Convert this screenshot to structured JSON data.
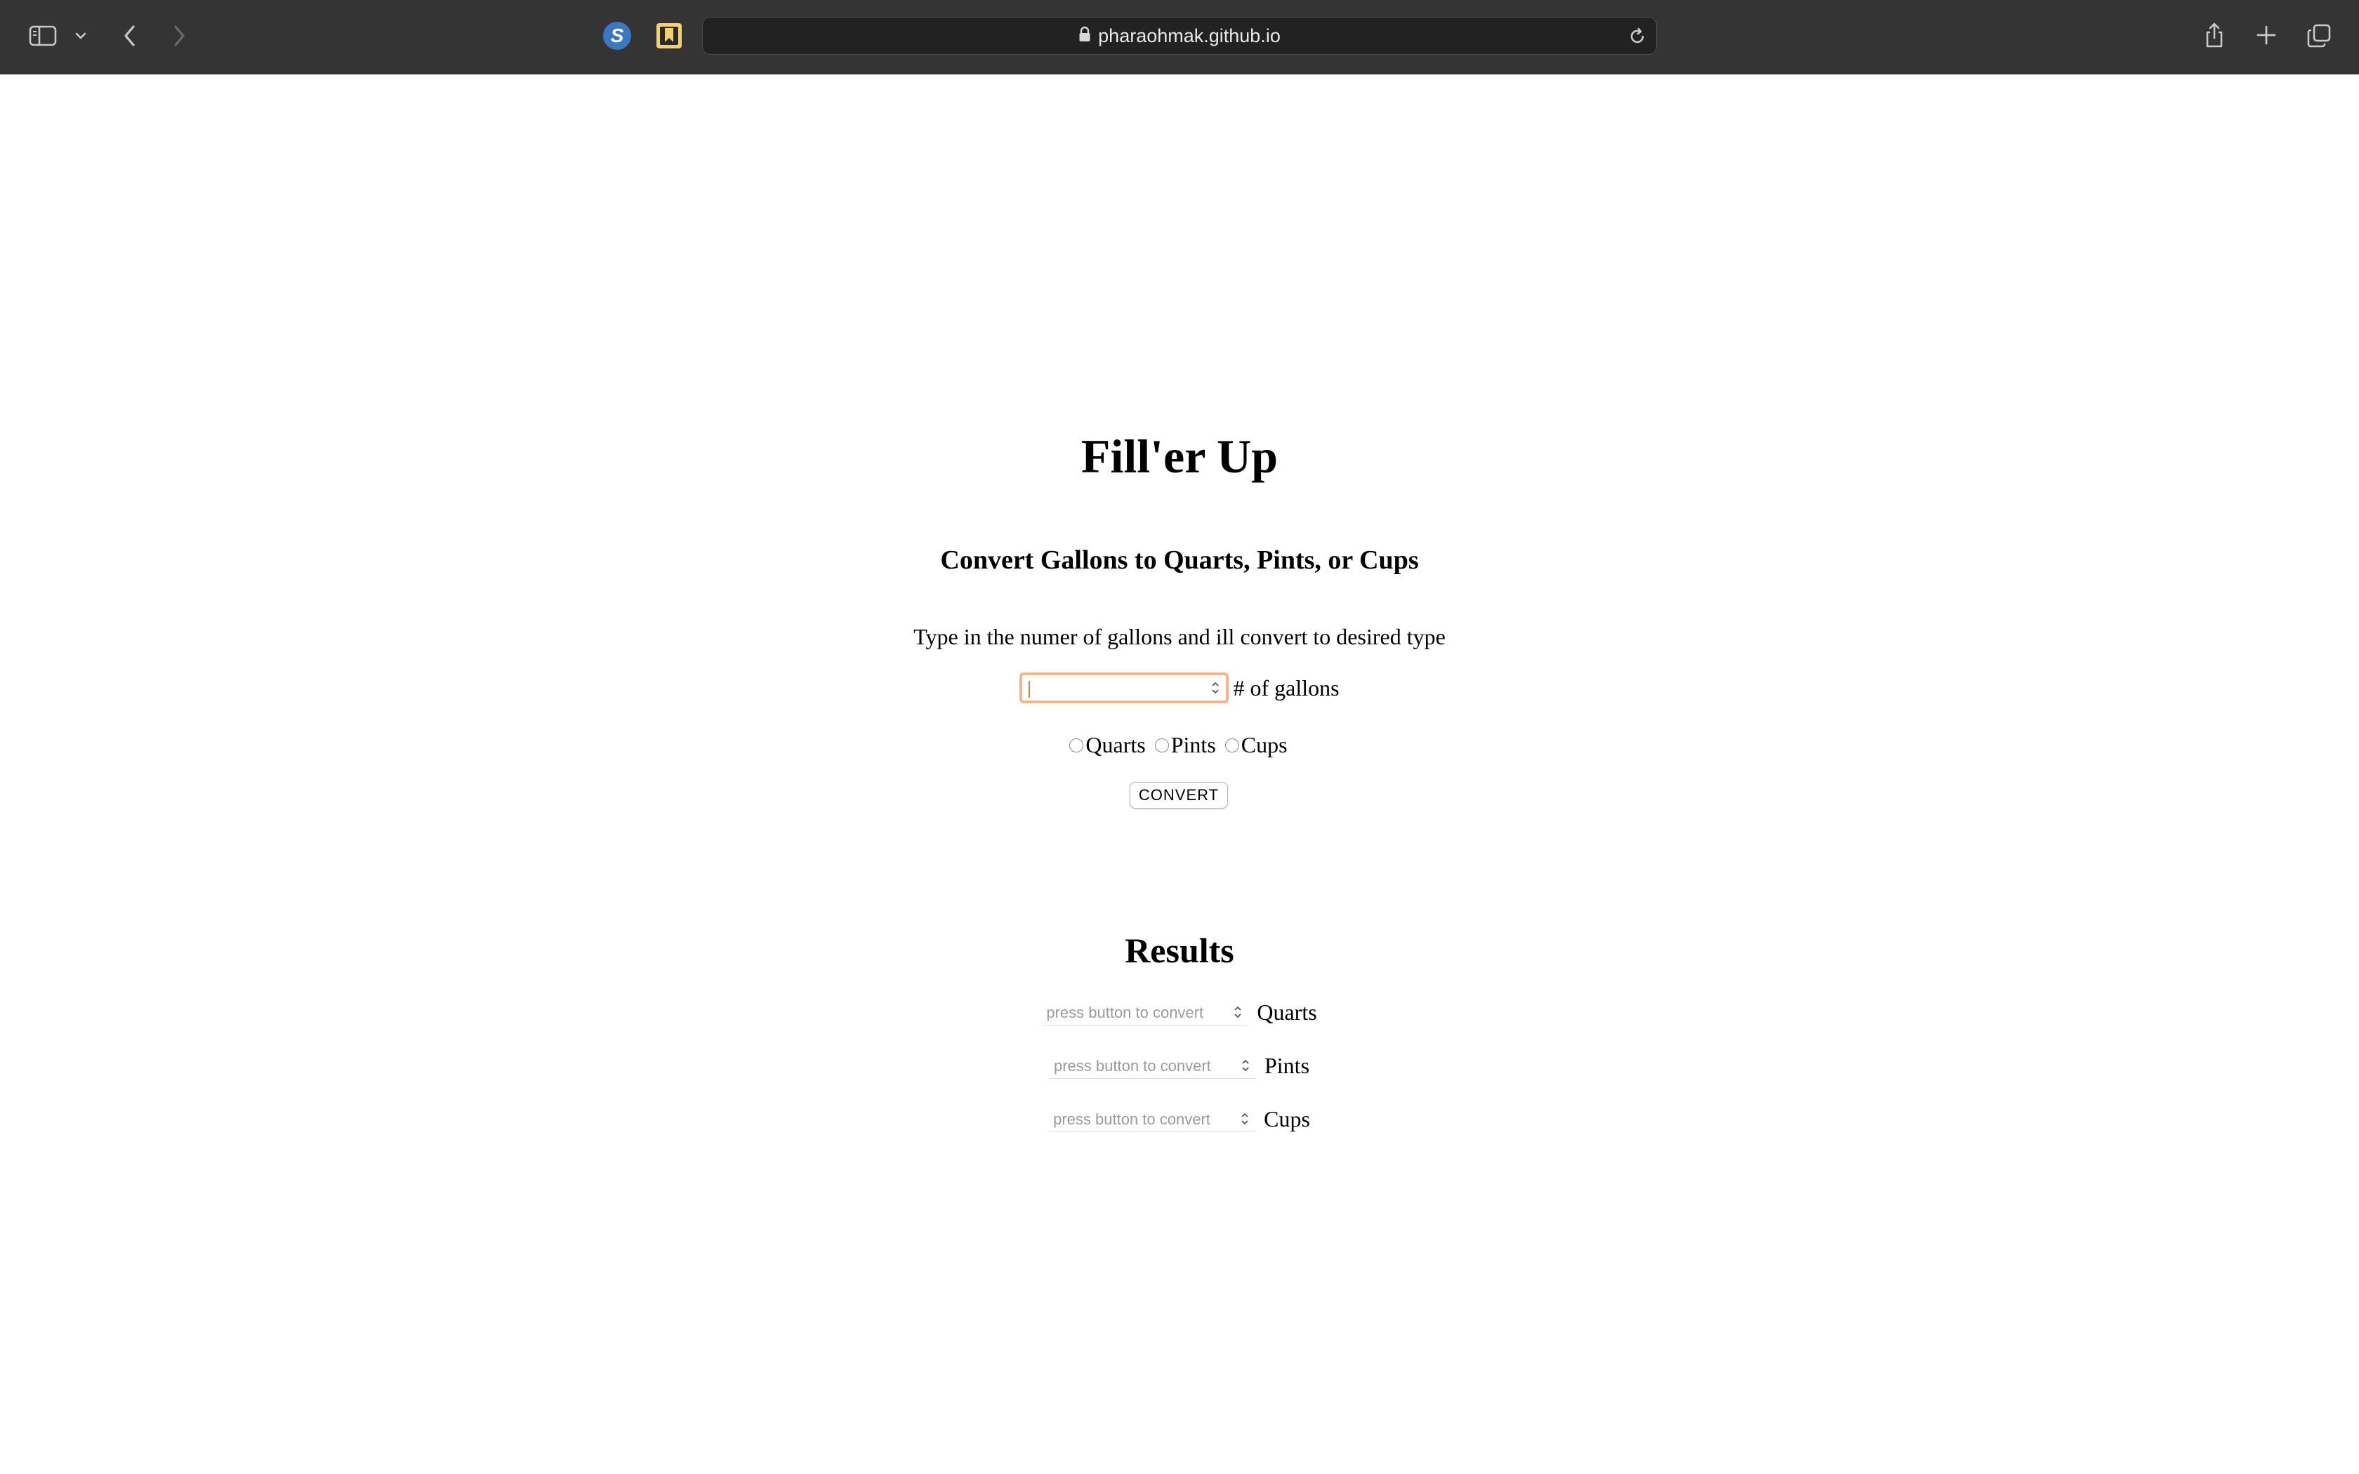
{
  "browser": {
    "url": "pharaohmak.github.io",
    "extension_s_letter": "S"
  },
  "page": {
    "title": "Fill'er Up",
    "subtitle": "Convert Gallons to Quarts, Pints, or Cups",
    "instructions": "Type in the numer of gallons and ill convert to desired type",
    "gallons_input": {
      "value": "",
      "label": "# of gallons"
    },
    "radios": [
      {
        "label": "Quarts",
        "checked": false
      },
      {
        "label": "Pints",
        "checked": false
      },
      {
        "label": "Cups",
        "checked": false
      }
    ],
    "convert_label": "CONVERT",
    "results_heading": "Results",
    "results": [
      {
        "placeholder": "press button to convert",
        "unit": "Quarts"
      },
      {
        "placeholder": "press button to convert",
        "unit": "Pints"
      },
      {
        "placeholder": "press button to convert",
        "unit": "Cups"
      }
    ]
  },
  "colors": {
    "toolbar_bg": "#343434",
    "urlbar_bg": "#222222",
    "focus_ring": "#f0b58a",
    "extension_blue": "#3a78c2",
    "bookmark_yellow": "#f4d06f"
  }
}
